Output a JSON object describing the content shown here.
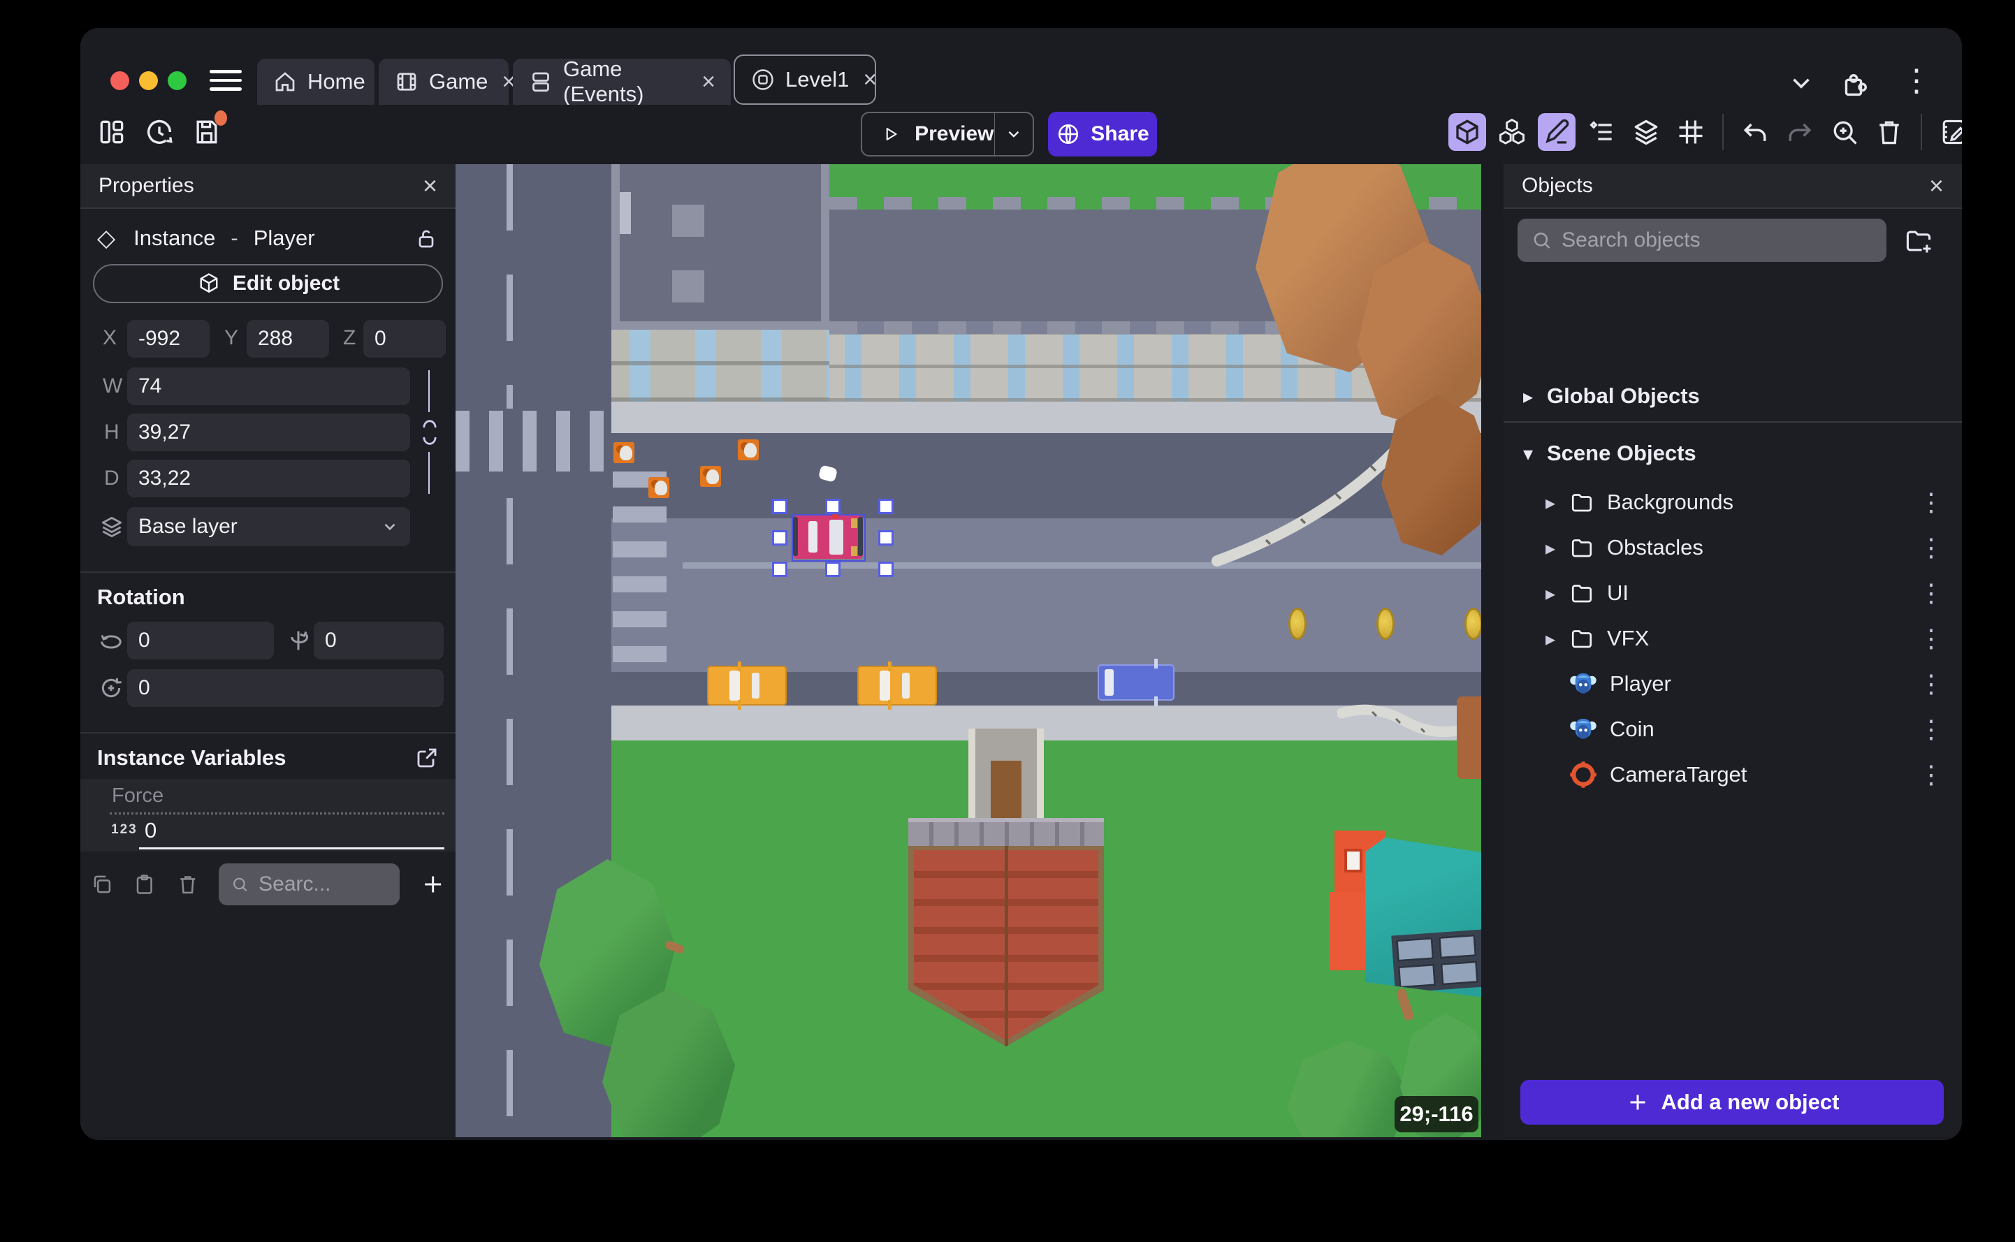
{
  "window": {
    "traffic_lights": [
      "#f6605a",
      "#f9bd31",
      "#2fc841"
    ]
  },
  "tabs": [
    {
      "label": "Home",
      "icon": "home-icon",
      "closable": false,
      "active": false
    },
    {
      "label": "Game",
      "icon": "film-icon",
      "closable": true,
      "active": false
    },
    {
      "label": "Game (Events)",
      "icon": "events-icon",
      "closable": true,
      "active": false
    },
    {
      "label": "Level1",
      "icon": "scene-icon",
      "closable": true,
      "active": true
    }
  ],
  "close_glyph": "×",
  "dots_glyph": "⋮",
  "toolbar": {
    "preview_label": "Preview",
    "share_label": "Share"
  },
  "properties": {
    "title": "Properties",
    "instance_label": "Instance",
    "separator": "-",
    "object_name": "Player",
    "edit_object_label": "Edit object",
    "coords": {
      "x_label": "X",
      "x": "-992",
      "y_label": "Y",
      "y": "288",
      "z_label": "Z",
      "z": "0"
    },
    "dims": {
      "w_label": "W",
      "w": "74",
      "h_label": "H",
      "h": "39,27",
      "d_label": "D",
      "d": "33,22"
    },
    "layer": {
      "value": "Base layer"
    },
    "rotation": {
      "title": "Rotation",
      "x": "0",
      "y": "0",
      "z": "0"
    },
    "variables": {
      "title": "Instance Variables",
      "rows": [
        {
          "name": "Force",
          "type_badge": "123",
          "value": "0"
        }
      ],
      "search_placeholder": "Searc..."
    }
  },
  "canvas": {
    "coordinate_badge": "29;-116",
    "scene_objects_visible": [
      "buildings",
      "autumn-tree",
      "traffic-cones",
      "selected-player-car",
      "taxi",
      "taxi",
      "blue-car",
      "coins",
      "tower",
      "house",
      "green-trees",
      "roads",
      "crosswalks"
    ]
  },
  "objects_panel": {
    "title": "Objects",
    "search_placeholder": "Search objects",
    "global_label": "Global Objects",
    "scene_label": "Scene Objects",
    "tree": [
      {
        "label": "Backgrounds",
        "type": "folder"
      },
      {
        "label": "Obstacles",
        "type": "folder"
      },
      {
        "label": "UI",
        "type": "folder"
      },
      {
        "label": "VFX",
        "type": "folder"
      },
      {
        "label": "Player",
        "type": "object"
      },
      {
        "label": "Coin",
        "type": "object"
      },
      {
        "label": "CameraTarget",
        "type": "target"
      }
    ],
    "add_button_label": "Add a new object",
    "expand_glyph": "▸",
    "collapse_glyph": "▾"
  },
  "colors": {
    "accent_purple": "#4e2ad4",
    "active_icon_bg": "#b7a7f3",
    "selection_blue": "#565ee4",
    "road_light": "#7c8096",
    "road_dark": "#5d6175",
    "sidewalk": "#c4c6ce",
    "grass": "#4aa54b",
    "player_car": "#d43a72",
    "taxi": "#f0a833",
    "coin": "#d9b239",
    "unsaved_dot": "#e8714b"
  }
}
